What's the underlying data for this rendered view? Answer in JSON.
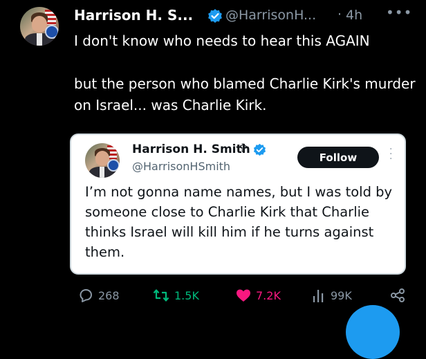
{
  "author": {
    "name": "Harrison H. S...",
    "handle": "@HarrisonH...",
    "separator": "·",
    "time": "4h",
    "more_icon": "more-horizontal-icon",
    "verified_color": "#1d9bf0"
  },
  "tweet": {
    "text": "I don't know who needs to hear this AGAIN\n\nbut the person who blamed Charlie Kirk's murder on Israel... was Charlie Kirk."
  },
  "quoted": {
    "name": "Harrison H. Smith",
    "cross_symbol": "✞",
    "handle": "@HarrisonHSmith",
    "follow_label": "Follow",
    "text": "I’m not gonna name names, but I was told by someone close to Charlie Kirk that Charlie thinks Israel will kill him if he turns against them."
  },
  "actions": {
    "replies": "268",
    "reposts": "1.5K",
    "likes": "7.2K",
    "views": "99K",
    "repost_color": "#00ba7c",
    "like_color": "#f91880"
  }
}
